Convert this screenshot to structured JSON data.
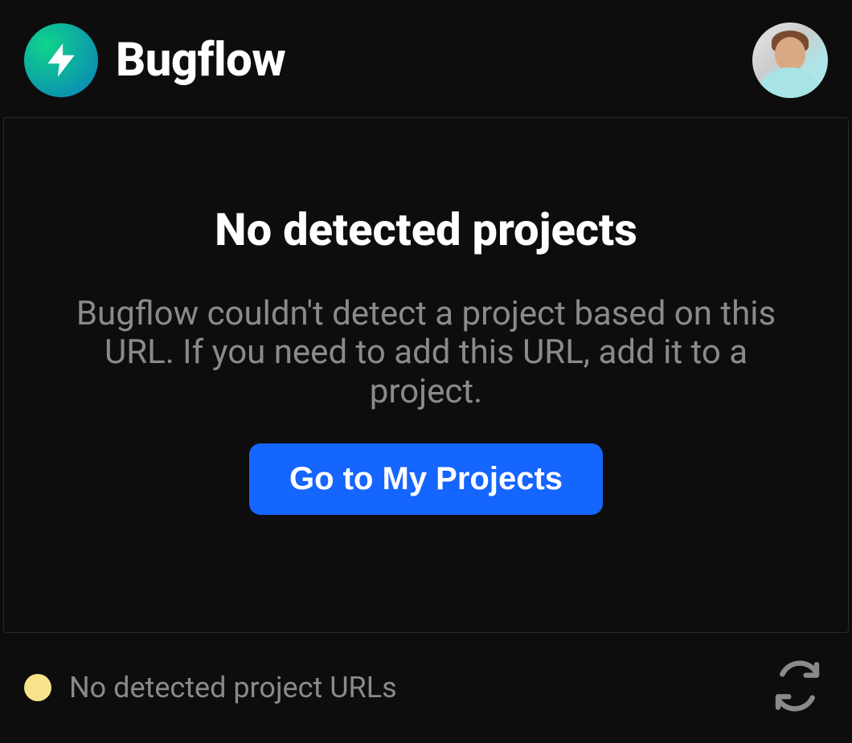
{
  "header": {
    "brand_name": "Bugflow"
  },
  "main": {
    "title": "No detected projects",
    "description": "Bugflow couldn't detect a project based on this URL. If you need to add this URL, add it to a project.",
    "button_label": "Go to My Projects"
  },
  "footer": {
    "status_text": "No detected project URLs",
    "status_color": "#f7e48a"
  }
}
